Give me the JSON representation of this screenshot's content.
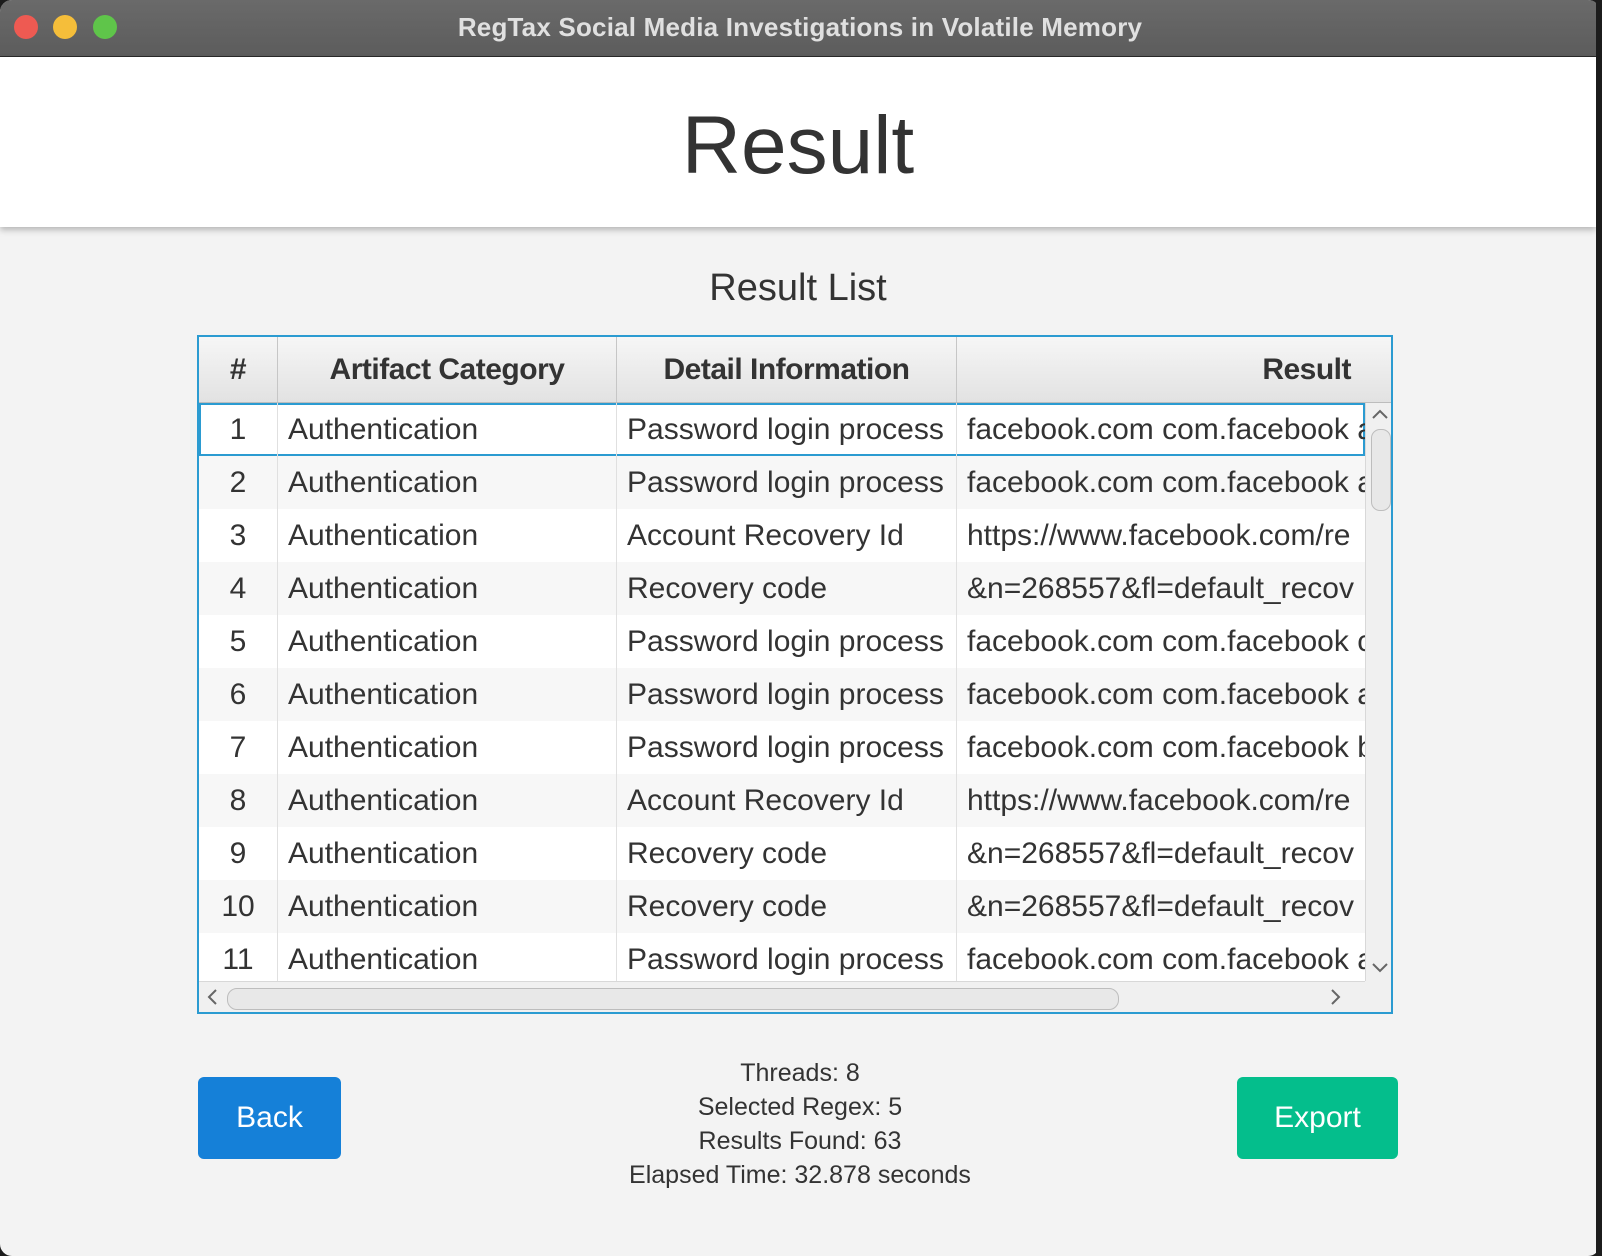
{
  "window": {
    "title": "RegTax Social Media Investigations in Volatile Memory"
  },
  "header": {
    "title": "Result"
  },
  "main": {
    "section_title": "Result List",
    "table": {
      "columns": [
        "#",
        "Artifact Category",
        "Detail Information",
        "Result"
      ],
      "rows": [
        [
          "1",
          "Authentication",
          "Password login process",
          "facebook.com com.facebook a"
        ],
        [
          "2",
          "Authentication",
          "Password login process",
          "facebook.com com.facebook a"
        ],
        [
          "3",
          "Authentication",
          "Account Recovery Id",
          "https://www.facebook.com/re"
        ],
        [
          "4",
          "Authentication",
          "Recovery code",
          "&n=268557&fl=default_recov"
        ],
        [
          "5",
          "Authentication",
          "Password login process",
          "facebook.com com.facebook c"
        ],
        [
          "6",
          "Authentication",
          "Password login process",
          "facebook.com com.facebook a"
        ],
        [
          "7",
          "Authentication",
          "Password login process",
          "facebook.com com.facebook b"
        ],
        [
          "8",
          "Authentication",
          "Account Recovery Id",
          "https://www.facebook.com/re"
        ],
        [
          "9",
          "Authentication",
          "Recovery code",
          "&n=268557&fl=default_recov"
        ],
        [
          "10",
          "Authentication",
          "Recovery code",
          "&n=268557&fl=default_recov"
        ],
        [
          "11",
          "Authentication",
          "Password login process",
          "facebook.com com.facebook a"
        ]
      ]
    },
    "stats": {
      "threads": "Threads: 8",
      "selected_regex": "Selected Regex: 5",
      "results_found": "Results Found: 63",
      "elapsed_time": "Elapsed Time: 32.878 seconds"
    }
  },
  "footer": {
    "back_label": "Back",
    "export_label": "Export"
  },
  "colors": {
    "accent": "#2b9bd1",
    "back_button": "#1580d8",
    "export_button": "#04be8c"
  },
  "icons": [
    "close-window-icon",
    "minimize-window-icon",
    "maximize-window-icon",
    "chevron-up-icon",
    "chevron-down-icon",
    "chevron-left-icon",
    "chevron-right-icon"
  ]
}
